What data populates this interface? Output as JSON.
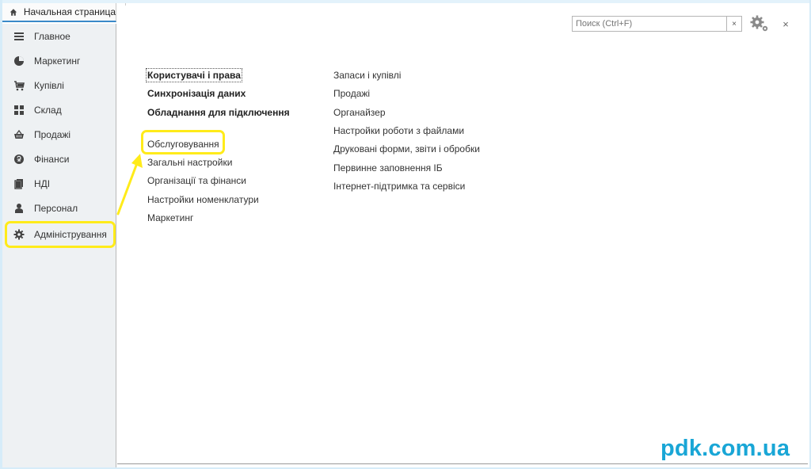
{
  "home_tab": {
    "label": "Начальная страница",
    "icon": "home-icon"
  },
  "sidebar": {
    "items": [
      {
        "label": "Главное",
        "icon": "menu-lines-icon"
      },
      {
        "label": "Маркетинг",
        "icon": "pie-chart-icon"
      },
      {
        "label": "Купівлі",
        "icon": "cart-icon"
      },
      {
        "label": "Склад",
        "icon": "grid-icon"
      },
      {
        "label": "Продажі",
        "icon": "basket-icon"
      },
      {
        "label": "Фінанси",
        "icon": "coin-icon"
      },
      {
        "label": "НДІ",
        "icon": "copy-icon"
      },
      {
        "label": "Персонал",
        "icon": "person-icon"
      },
      {
        "label": "Адміністрування",
        "icon": "gear-icon"
      }
    ]
  },
  "search": {
    "placeholder": "Поиск (Ctrl+F)",
    "clear": "×"
  },
  "window": {
    "close": "×"
  },
  "columns": {
    "left": [
      {
        "label": "Користувачі і права",
        "bold": true
      },
      {
        "label": "Синхронізація даних",
        "bold": true
      },
      {
        "label": "Обладнання для підключення",
        "bold": true
      },
      {
        "label": "Обслуговування",
        "bold": false
      },
      {
        "label": "Загальні настройки",
        "bold": false
      },
      {
        "label": "Організації та фінанси",
        "bold": false
      },
      {
        "label": "Настройки номенклатури",
        "bold": false
      },
      {
        "label": "Маркетинг",
        "bold": false
      }
    ],
    "right": [
      {
        "label": "Запаси і купівлі"
      },
      {
        "label": "Продажі"
      },
      {
        "label": "Органайзер"
      },
      {
        "label": "Настройки роботи з файлами"
      },
      {
        "label": "Друковані форми, звіти і обробки"
      },
      {
        "label": "Первинне заповнення ІБ"
      },
      {
        "label": "Інтернет-підтримка та сервіси"
      }
    ]
  },
  "highlight_color": "#ffeb1a",
  "watermark": "pdk.com.ua"
}
